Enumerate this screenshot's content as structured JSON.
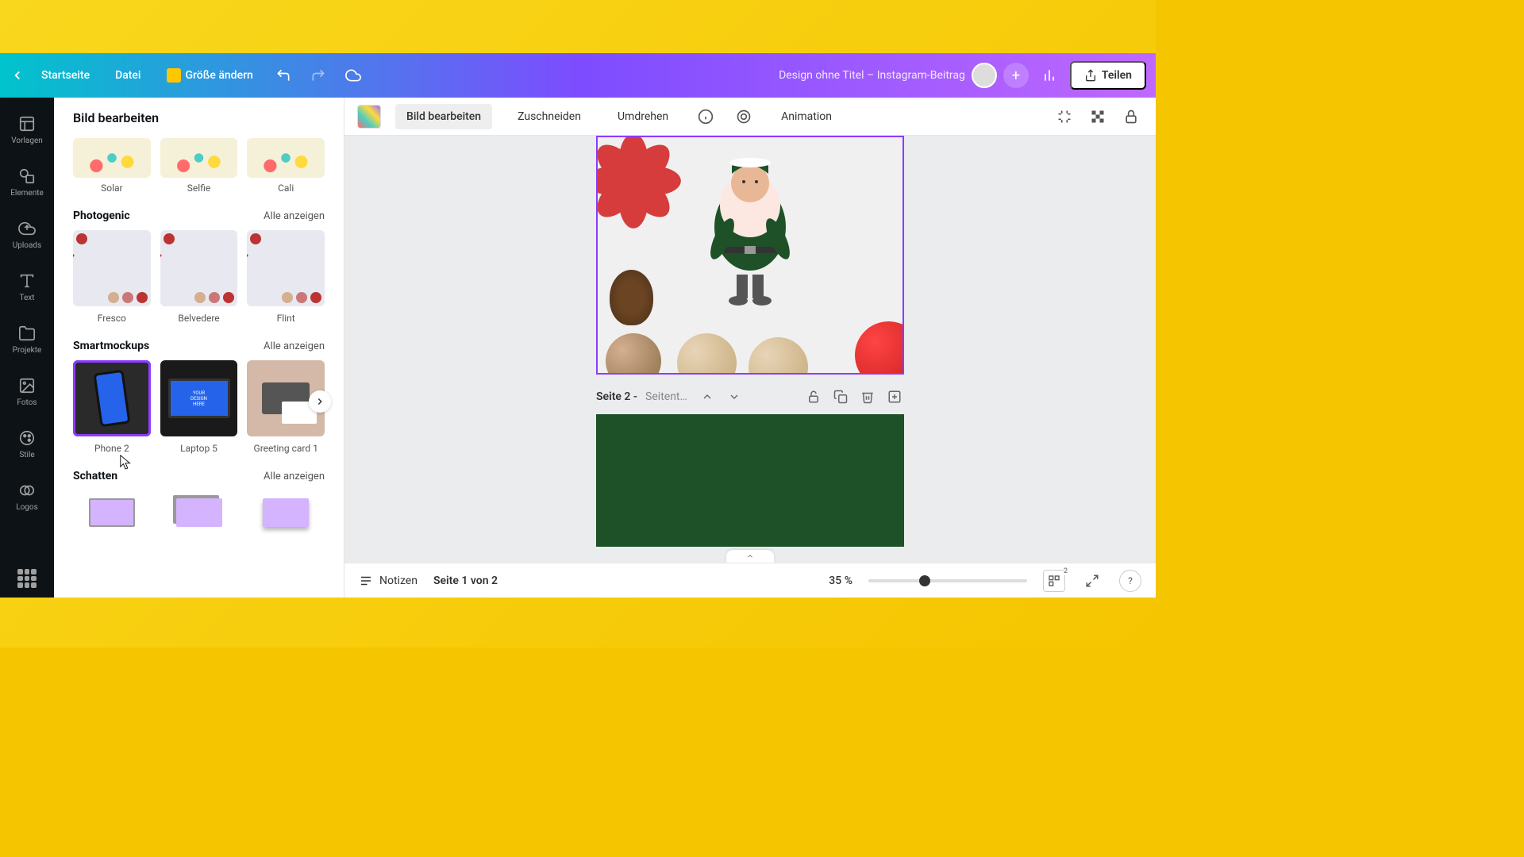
{
  "topbar": {
    "home": "Startseite",
    "file": "Datei",
    "resize": "Größe ändern",
    "doc_title": "Design ohne Titel – Instagram-Beitrag",
    "share": "Teilen"
  },
  "rail": {
    "templates": "Vorlagen",
    "elements": "Elemente",
    "uploads": "Uploads",
    "text": "Text",
    "projects": "Projekte",
    "photos": "Fotos",
    "styles": "Stile",
    "logos": "Logos"
  },
  "panel": {
    "title": "Bild bearbeiten",
    "see_all": "Alle anzeigen",
    "filters_top": {
      "items": [
        "Solar",
        "Selfie",
        "Cali"
      ]
    },
    "photogenic": {
      "title": "Photogenic",
      "items": [
        "Fresco",
        "Belvedere",
        "Flint"
      ]
    },
    "smartmockups": {
      "title": "Smartmockups",
      "items": [
        "Phone 2",
        "Laptop 5",
        "Greeting card 1"
      ]
    },
    "shadow": {
      "title": "Schatten"
    }
  },
  "contextbar": {
    "edit_image": "Bild bearbeiten",
    "crop": "Zuschneiden",
    "flip": "Umdrehen",
    "animation": "Animation"
  },
  "canvas": {
    "page2_label": "Seite 2 -",
    "page2_placeholder": "Seitentitel hi…",
    "page2_color": "#1e5128"
  },
  "footer": {
    "notes": "Notizen",
    "page_of": "Seite 1 von 2",
    "zoom": "35 %",
    "page_count": "2"
  }
}
